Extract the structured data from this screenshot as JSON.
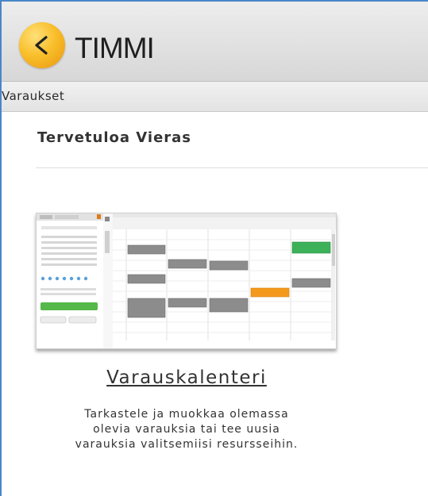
{
  "app": {
    "name": "TIMMI"
  },
  "nav": {
    "items": [
      {
        "label": "Varaukset"
      }
    ]
  },
  "main": {
    "welcome": "Tervetuloa  Vieras",
    "tiles": [
      {
        "title": "Varauskalenteri",
        "description_lines": [
          "Tarkastele ja muokkaa olemassa",
          "olevia varauksia tai tee uusia",
          "varauksia valitsemiisi resursseihin."
        ]
      }
    ]
  },
  "colors": {
    "accent_blue": "#4a86c8",
    "logo_orange": "#f9bf2b",
    "event_gray": "#8c8c8c",
    "event_green": "#3cb15a",
    "event_orange": "#f39a1c"
  },
  "icons": [
    "back-arrow-icon"
  ]
}
